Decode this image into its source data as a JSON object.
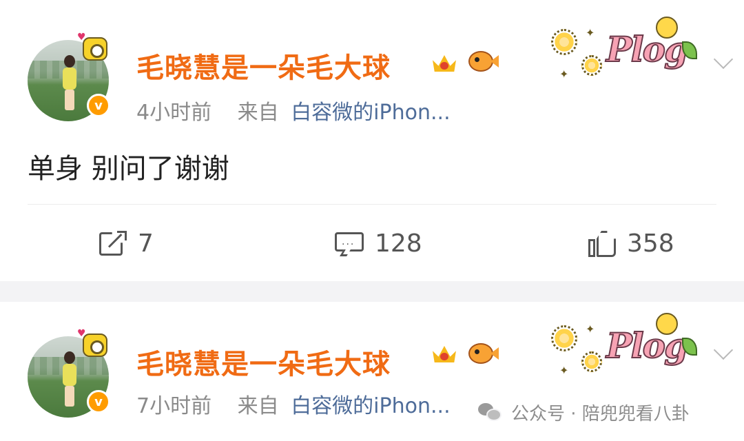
{
  "posts": [
    {
      "username": "毛晓慧是一朵毛大球",
      "time": "4小时前",
      "from_label": "来自",
      "source": "白容微的iPhon...",
      "content": "单身 别问了谢谢",
      "verified_badge": "v",
      "sticker_text": "Plog",
      "actions": {
        "share": "7",
        "comment": "128",
        "like": "358"
      }
    },
    {
      "username": "毛晓慧是一朵毛大球",
      "time": "7小时前",
      "from_label": "来自",
      "source": "白容微的iPhon...",
      "verified_badge": "v",
      "sticker_text": "Plog"
    }
  ],
  "watermark": {
    "text": "公众号 · 陪兜兜看八卦"
  },
  "colors": {
    "username": "#f06b14",
    "source_link": "#4e6c99",
    "meta": "#8a8a8a",
    "verified": "#ff9c00"
  }
}
